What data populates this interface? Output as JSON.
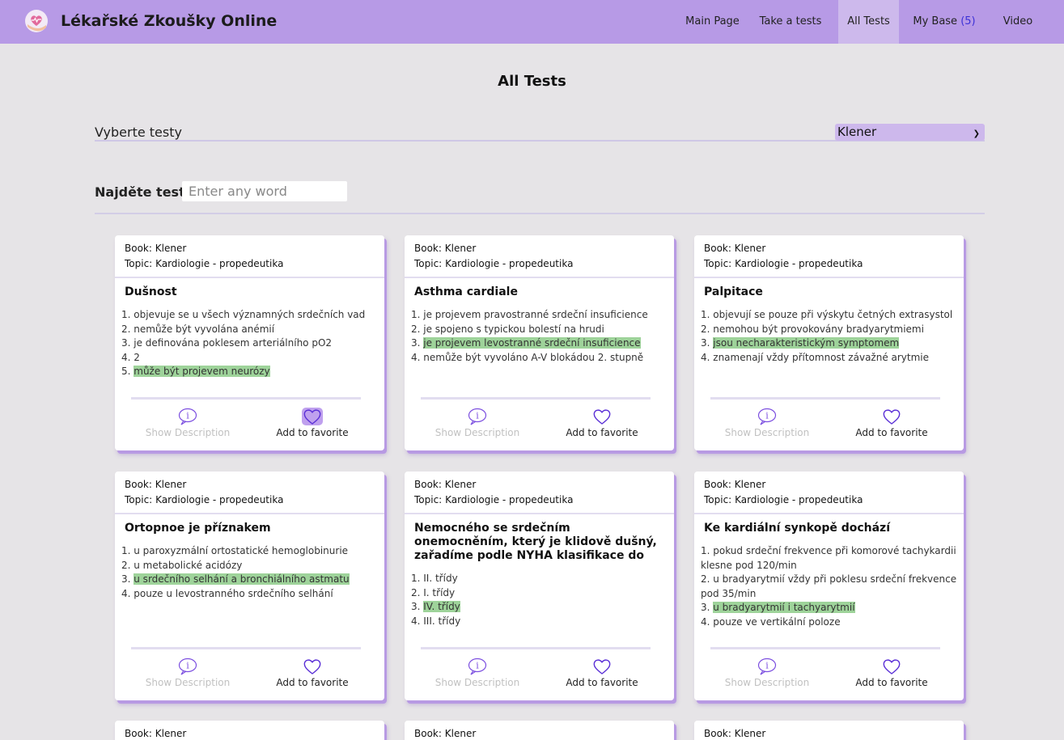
{
  "app": {
    "title": "Lékařské Zkoušky Online"
  },
  "nav": [
    {
      "label": "Main Page",
      "count": ""
    },
    {
      "label": "Take a tests",
      "count": ""
    },
    {
      "label": "All Tests",
      "count": ""
    },
    {
      "label": "My Base",
      "count": "(5)"
    },
    {
      "label": "Video",
      "count": ""
    }
  ],
  "page": {
    "title": "All Tests"
  },
  "filter": {
    "label": "Vyberte testy",
    "selected": "Klener"
  },
  "search": {
    "label": "Najděte test",
    "placeholder": "Enter any word"
  },
  "labels": {
    "book": "Book:",
    "topic": "Topic:",
    "show_description": "Show Description",
    "add_favorite": "Add to favorite"
  },
  "colors": {
    "header": "#b79ae6",
    "highlight": "#9ed39a",
    "accent": "#7c4fe0"
  },
  "cards": [
    {
      "book": "Klener",
      "topic": "Kardiologie - propedeutika",
      "question": "Dušnost",
      "answers": [
        "objevuje se u všech významných srdečních vad",
        "nemůže být vyvolána anémií",
        "je definována poklesem arteriálního pO2",
        "2",
        "může být projevem neurózy"
      ],
      "correct": 5,
      "favorite_active": true
    },
    {
      "book": "Klener",
      "topic": "Kardiologie - propedeutika",
      "question": "Asthma cardiale",
      "answers": [
        "je projevem pravostranné srdeční insuficience",
        "je spojeno s typickou bolestí na hrudi",
        "je projevem levostranné srdeční insuficience",
        "nemůže být vyvoláno A-V blokádou 2. stupně"
      ],
      "correct": 3,
      "favorite_active": false
    },
    {
      "book": "Klener",
      "topic": "Kardiologie - propedeutika",
      "question": "Palpitace",
      "answers": [
        "objevují se pouze při výskytu četných extrasystol",
        "nemohou být provokovány bradyarytmiemi",
        "jsou necharakteristickým symptomem",
        "znamenají vždy přítomnost závažné arytmie"
      ],
      "correct": 3,
      "favorite_active": false
    },
    {
      "book": "Klener",
      "topic": "Kardiologie - propedeutika",
      "question": "Ortopnoe je příznakem",
      "answers": [
        "u paroxyzmální ortostatické hemoglobinurie",
        "u metabolické acidózy",
        "u srdečního selhání a bronchiálního astmatu",
        "pouze u levostranného srdečního selhání"
      ],
      "correct": 3,
      "favorite_active": false
    },
    {
      "book": "Klener",
      "topic": "Kardiologie - propedeutika",
      "question": "Nemocného se srdečním onemocněním, který je klidově dušný, zařadíme podle NYHA klasifikace do",
      "answers": [
        "II. třídy",
        "I. třídy",
        "IV. třídy",
        "III. třídy"
      ],
      "correct": 3,
      "favorite_active": false
    },
    {
      "book": "Klener",
      "topic": "Kardiologie - propedeutika",
      "question": "Ke kardiální synkopě dochází",
      "answers": [
        "pokud srdeční frekvence při komorové tachykardii klesne pod 120/min",
        "u bradyarytmií vždy při poklesu srdeční frekvence pod 35/min",
        "u bradyarytmií i tachyarytmií",
        "pouze ve vertikální poloze"
      ],
      "correct": 3,
      "favorite_active": false
    },
    {
      "book": "Klener"
    },
    {
      "book": "Klener"
    },
    {
      "book": "Klener"
    }
  ]
}
